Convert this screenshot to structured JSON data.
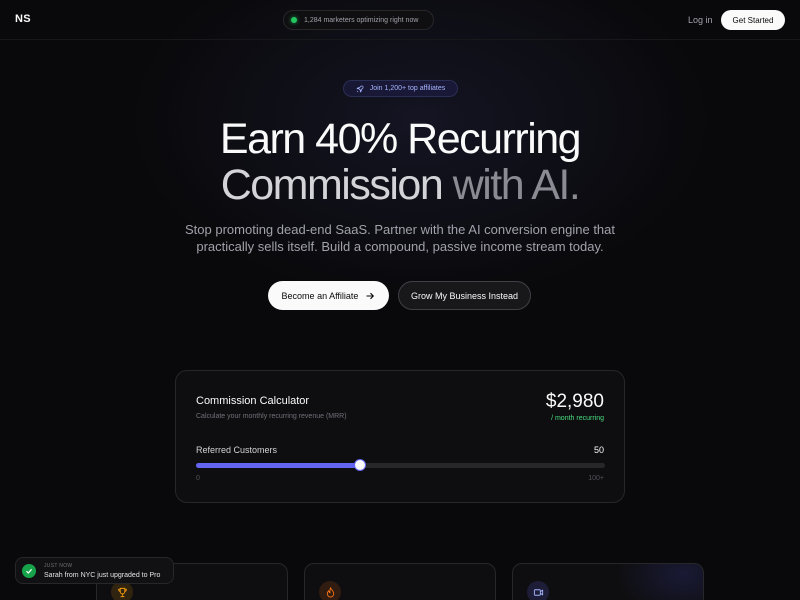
{
  "nav": {
    "logo": "NS",
    "live_count_text": "1,284 marketers optimizing right now",
    "login_label": "Log in",
    "get_started_label": "Get Started"
  },
  "hero": {
    "badge_text": "Join 1,200+ top affiliates",
    "badge_icon": "rocket-icon",
    "headline_line1": "Earn 40% Recurring",
    "headline_line2_part1": "Commission ",
    "headline_line2_part2": "with AI.",
    "subtitle_line1": "Stop promoting dead-end SaaS. Partner with the AI conversion engine that",
    "subtitle_line2": "practically sells itself. Build a compound, passive income stream today.",
    "primary_cta": "Become an Affiliate",
    "primary_cta_icon": "arrow-right-icon",
    "secondary_cta": "Grow My Business Instead"
  },
  "calculator": {
    "title": "Commission Calculator",
    "subtitle": "Calculate your monthly recurring revenue (MRR)",
    "amount": "$2,980",
    "period": "/ month recurring",
    "slider_label": "Referred Customers",
    "slider_value": "50",
    "slider_min_label": "0",
    "slider_max_label": "100+",
    "slider_fraction": 0.4
  },
  "feature_cards": [
    {
      "icon": "trophy-icon",
      "accent": "#f59e0b"
    },
    {
      "icon": "flame-icon",
      "accent": "#f97316"
    },
    {
      "icon": "video-icon",
      "accent": "#818cf8"
    }
  ],
  "toast": {
    "time": "JUST NOW",
    "message": "Sarah from NYC just upgraded to Pro"
  },
  "colors": {
    "accent": "#6366f1",
    "success": "#22c55e",
    "background": "#09090b"
  }
}
